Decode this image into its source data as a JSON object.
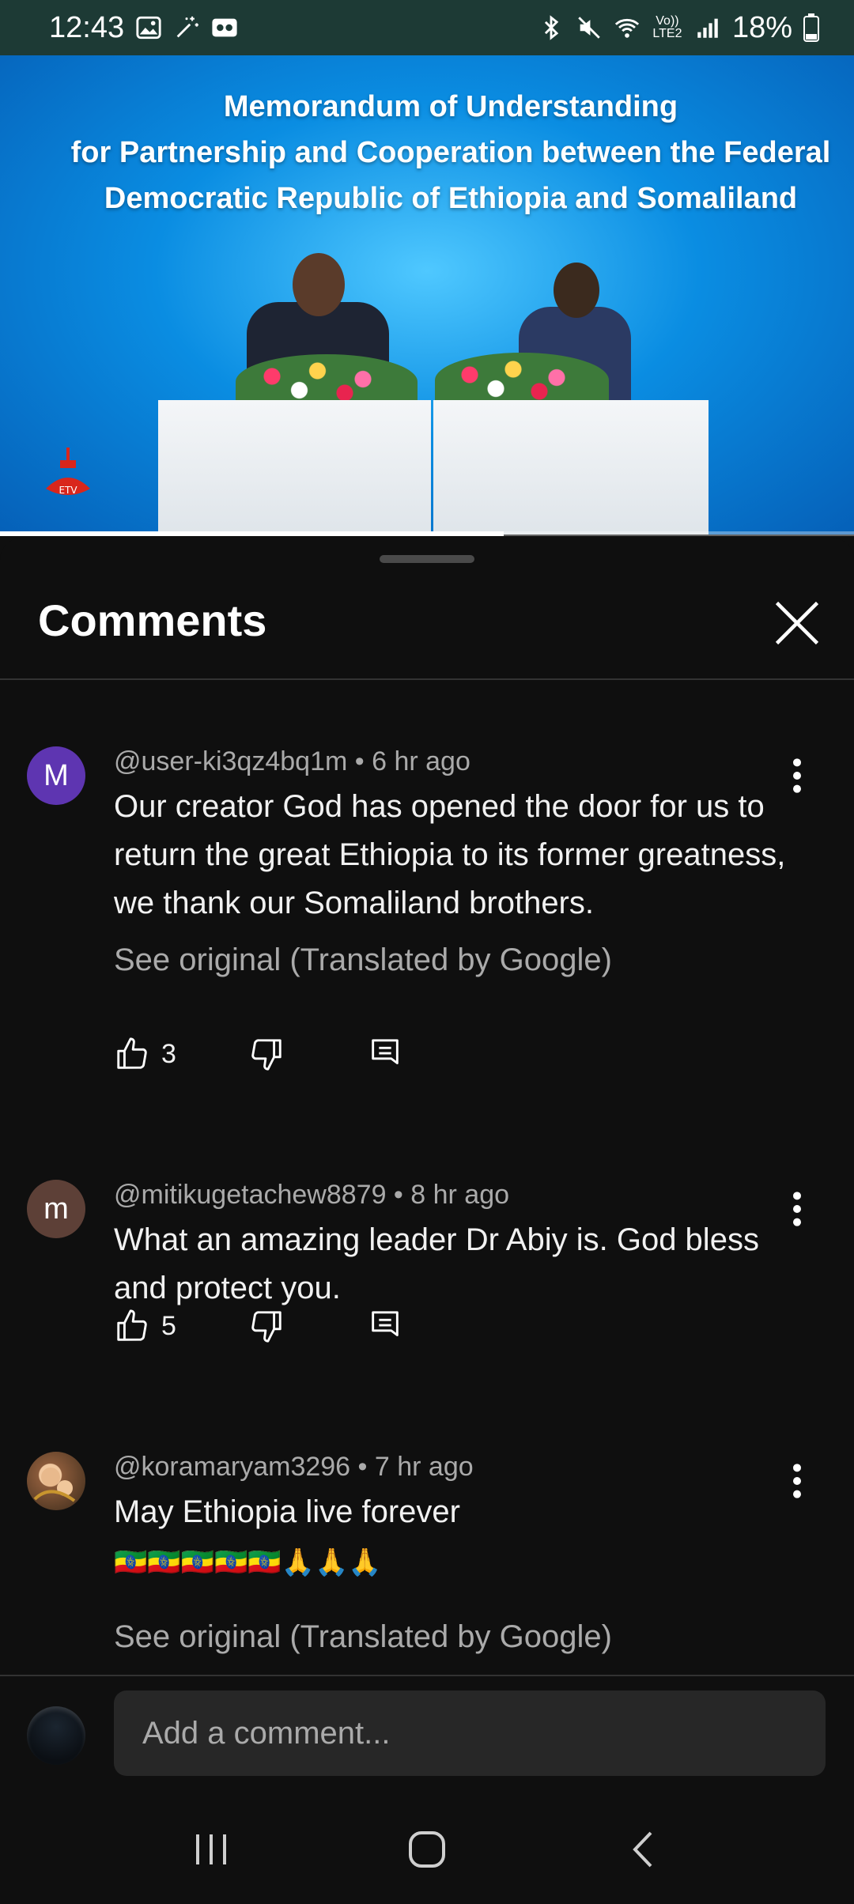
{
  "status_bar": {
    "time": "12:43",
    "network_label": "Vo)) LTE2",
    "battery": "18%"
  },
  "video": {
    "title_lines": [
      "Memorandum of Understanding",
      "for Partnership and Cooperation between the Federal",
      "Democratic Republic of Ethiopia and Somaliland"
    ],
    "channel_logo": "ETV",
    "progress_fraction": 0.59
  },
  "sheet": {
    "title": "Comments",
    "close_icon": "close-icon"
  },
  "comments": [
    {
      "avatar_letter": "M",
      "avatar_color": "#5e35b1",
      "meta": "@user-ki3qz4bq1m • 6 hr ago",
      "text": "Our creator God has opened the door for us to return the great Ethiopia to its former greatness, we thank our Somaliland brothers.",
      "see_original": "See original (Translated by Google)",
      "likes": "3"
    },
    {
      "avatar_letter": "m",
      "avatar_color": "#5d4037",
      "meta": "@mitikugetachew8879 • 8 hr ago",
      "text": "What an amazing leader Dr Abiy is. God bless and protect you.",
      "likes": "5"
    },
    {
      "avatar_letter": "",
      "avatar_color": "#8a5a3a",
      "meta": "@koramaryam3296 • 7 hr ago",
      "text": "May Ethiopia live forever",
      "emoji_line": "🇪🇹🇪🇹🇪🇹🇪🇹🇪🇹🙏🙏🙏",
      "see_original": "See original (Translated by Google)"
    }
  ],
  "composer": {
    "placeholder": "Add a comment..."
  }
}
